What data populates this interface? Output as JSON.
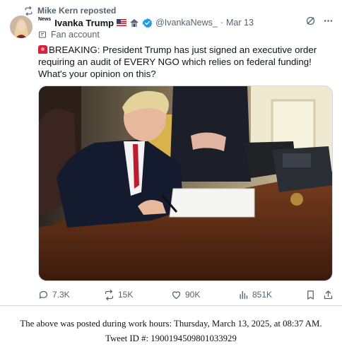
{
  "repost": {
    "text": "Mike Kern reposted",
    "icon": "repost-icon"
  },
  "author": {
    "news_tag": "News",
    "name": "Ivanka Trump",
    "handle": "@IvankaNews_",
    "separator": "·",
    "date": "Mar 13",
    "badges": [
      "us-flag-icon",
      "house-emoji-icon",
      "verified-badge-icon"
    ],
    "verified_color": "#1d9bf0",
    "account_label": "Fan account"
  },
  "tweet": {
    "text": "BREAKING: President Trump has just signed an executive order requiring an audit of EVERY NGO which relies on federal funding! What's your opinion on this?"
  },
  "actions": {
    "replies": "7.3K",
    "reposts": "15K",
    "likes": "90K",
    "views": "851K"
  },
  "caption": {
    "line1": "The above was posted during work hours: Thursday, March 13, 2025, at 08:37 AM.",
    "line2": "Tweet ID #: 1900194509801033929"
  },
  "colors": {
    "text": "#0f1419",
    "secondary": "#536471",
    "accent": "#1d9bf0"
  }
}
